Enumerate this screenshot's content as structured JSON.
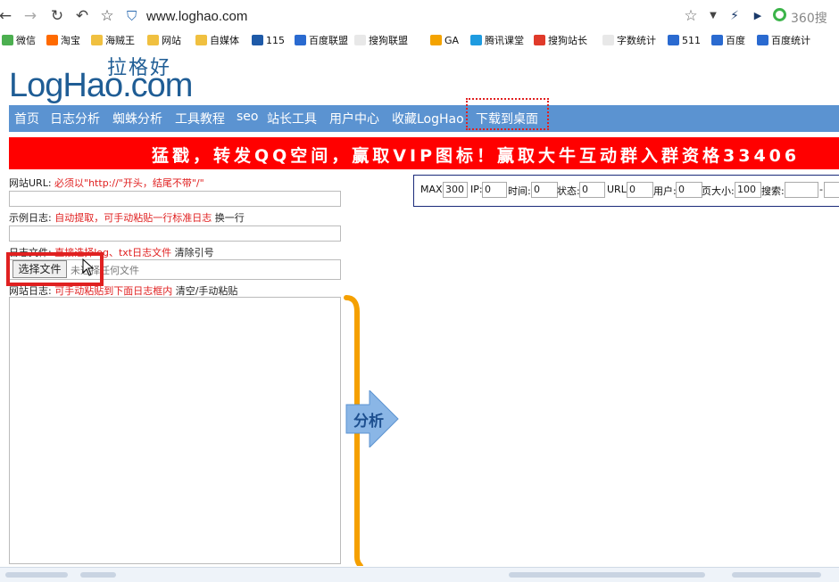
{
  "browser": {
    "url": "www.loghao.com",
    "search_engine": "360搜"
  },
  "bookmarks": [
    {
      "label": "微信",
      "color": "#4caf50"
    },
    {
      "label": "淘宝",
      "color": "#ff6a00"
    },
    {
      "label": "海贼王",
      "color": "#f0c040"
    },
    {
      "label": "网站",
      "color": "#f0c040"
    },
    {
      "label": "自媒体",
      "color": "#f0c040"
    },
    {
      "label": "115",
      "color": "#1e5aa8"
    },
    {
      "label": "百度联盟",
      "color": "#2a6ad0"
    },
    {
      "label": "搜狗联盟",
      "color": "#e8e8e8"
    },
    {
      "label": "GA",
      "color": "#f4a300"
    },
    {
      "label": "腾讯课堂",
      "color": "#1e9be0"
    },
    {
      "label": "搜狗站长",
      "color": "#e03a2a"
    },
    {
      "label": "字数统计",
      "color": "#e8e8e8"
    },
    {
      "label": "511",
      "color": "#2a6ad0"
    },
    {
      "label": "百度",
      "color": "#2a6ad0"
    },
    {
      "label": "百度统计",
      "color": "#2a6ad0"
    }
  ],
  "logo": {
    "cn": "拉格好",
    "en": "LogHao.com"
  },
  "nav": [
    "首页",
    "日志分析",
    "蜘蛛分析",
    "工具教程",
    "seo",
    "站长工具",
    "用户中心",
    "收藏LogHao",
    "下载到桌面"
  ],
  "banner": {
    "text": "猛戳，转发QQ空间，赢取VIP图标！赢取大牛互动群入群资格33406"
  },
  "form": {
    "site_url_label": "网站URL:",
    "site_url_hint": "必须以\"http://\"开头，结尾不带\"/\"",
    "sample_log_label": "示例日志:",
    "sample_log_hint": "自动提取，可手动粘贴一行标准日志",
    "sample_log_action": "换一行",
    "log_file_label": "日志文件:",
    "log_file_hint": "直接选择log、txt日志文件",
    "log_file_action": "清除引号",
    "file_button": "选择文件",
    "file_status": "未选择任何文件",
    "site_log_label": "网站日志:",
    "site_log_hint": "可手动粘贴到下面日志框内",
    "site_log_action": "清空/手动粘贴"
  },
  "analyze_label": "分析",
  "stats": {
    "max_label": "MAX:",
    "max_value": "300",
    "ip_label": "IP:",
    "ip_value": "0",
    "time_label": "时间:",
    "time_value": "0",
    "status_label": "状态:",
    "status_value": "0",
    "url_label": "URL:",
    "url_value": "0",
    "user_label": "用户:",
    "user_value": "0",
    "page_size_label": "页大小:",
    "page_size_value": "100",
    "search_label": "搜索:",
    "dash": "-"
  },
  "colors": {
    "nav_bg": "#5b93d1",
    "banner_bg": "#ff0000",
    "highlight": "#e02020",
    "brace": "#f5a000",
    "arrow": "#8ab6e6"
  }
}
